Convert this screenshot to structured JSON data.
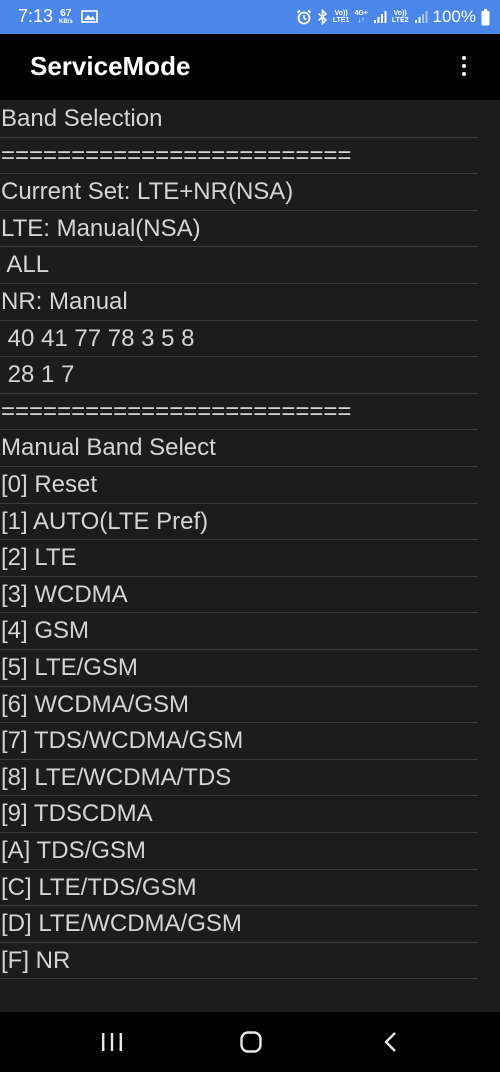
{
  "status_bar": {
    "time": "7:13",
    "speed_value": "67",
    "speed_unit": "KB/s",
    "volte1_top": "Vo))",
    "volte1_bottom": "LTE1",
    "net_type_top": "4G+",
    "net_type_bottom": "↓↑",
    "volte2_top": "Vo))",
    "volte2_bottom": "LTE2",
    "battery": "100%",
    "icons": [
      "gallery-icon",
      "alarm-icon",
      "bluetooth-icon",
      "signal-icon",
      "signal-icon",
      "battery-icon"
    ]
  },
  "app_bar": {
    "title": "ServiceMode",
    "menu_icon": "more-vert-icon"
  },
  "lines": [
    "Band Selection",
    "=========================",
    "Current Set: LTE+NR(NSA)",
    "LTE: Manual(NSA)",
    " ALL",
    "NR: Manual",
    " 40 41 77 78 3 5 8",
    " 28 1 7",
    "=========================",
    "Manual Band Select",
    "[0] Reset",
    "[1] AUTO(LTE Pref)",
    "[2] LTE",
    "[3] WCDMA",
    "[4] GSM",
    "[5] LTE/GSM",
    "[6] WCDMA/GSM",
    "[7] TDS/WCDMA/GSM",
    "[8] LTE/WCDMA/TDS",
    "[9] TDSCDMA",
    "[A] TDS/GSM",
    "[C] LTE/TDS/GSM",
    "[D] LTE/WCDMA/GSM",
    "[F] NR"
  ],
  "nav_bar": {
    "icons": [
      "recent-apps-icon",
      "home-icon",
      "back-icon"
    ]
  }
}
